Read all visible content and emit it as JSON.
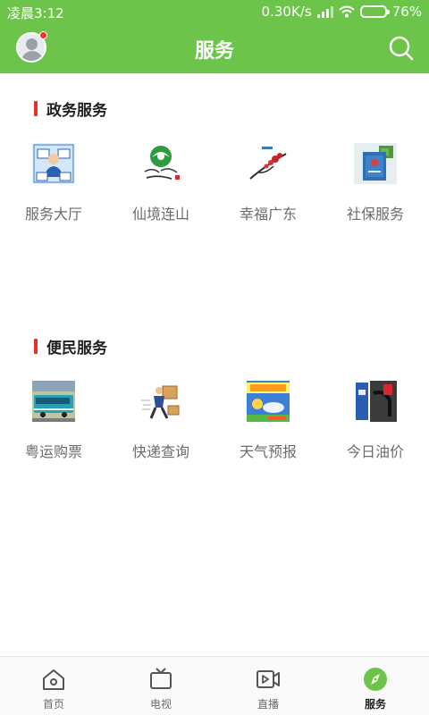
{
  "status_bar": {
    "time": "凌晨3:12",
    "net_speed": "0.30K/s",
    "battery": "76%",
    "battery_level": 0.76
  },
  "header": {
    "title": "服务"
  },
  "sections": [
    {
      "title": "政务服务",
      "items": [
        {
          "label": "服务大厅",
          "icon": "service-hall-thumbnail"
        },
        {
          "label": "仙境连山",
          "icon": "lianshan-logo-thumbnail"
        },
        {
          "label": "幸福广东",
          "icon": "happy-guangdong-thumbnail"
        },
        {
          "label": "社保服务",
          "icon": "social-security-thumbnail"
        }
      ]
    },
    {
      "title": "便民服务",
      "items": [
        {
          "label": "粤运购票",
          "icon": "bus-ticket-thumbnail"
        },
        {
          "label": "快递查询",
          "icon": "courier-thumbnail"
        },
        {
          "label": "天气预报",
          "icon": "weather-thumbnail"
        },
        {
          "label": "今日油价",
          "icon": "fuel-price-thumbnail"
        }
      ]
    }
  ],
  "tabs": [
    {
      "label": "首页",
      "icon": "home-icon",
      "active": false
    },
    {
      "label": "电视",
      "icon": "tv-icon",
      "active": false
    },
    {
      "label": "直播",
      "icon": "live-video-icon",
      "active": false
    },
    {
      "label": "服务",
      "icon": "compass-icon",
      "active": true
    }
  ],
  "colors": {
    "brand_green": "#6cc54a",
    "section_marker_red": "#e8312b",
    "notification_red": "#ff2e2e"
  }
}
